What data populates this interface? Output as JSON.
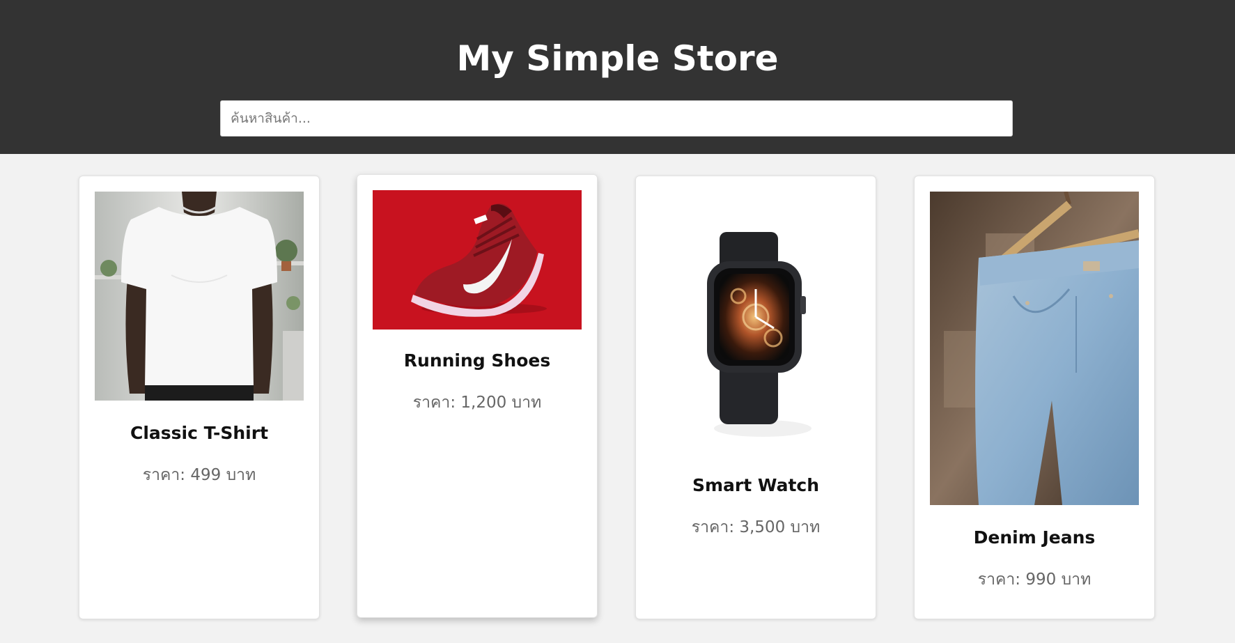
{
  "header": {
    "title": "My Simple Store",
    "search_placeholder": "ค้นหาสินค้า..."
  },
  "colors": {
    "header_bg": "#333333",
    "page_bg": "#f2f2f2",
    "card_bg": "#ffffff",
    "price_text": "#666666"
  },
  "products": [
    {
      "name": "Classic T-Shirt",
      "price": "ราคา: 499 บาท",
      "image": "white-tshirt-photo"
    },
    {
      "name": "Running Shoes",
      "price": "ราคา: 1,200 บาท",
      "image": "red-running-shoe-photo"
    },
    {
      "name": "Smart Watch",
      "price": "ราคา: 3,500 บาท",
      "image": "black-smartwatch-photo"
    },
    {
      "name": "Denim Jeans",
      "price": "ราคา: 990 บาท",
      "image": "denim-jeans-on-hanger-photo"
    }
  ]
}
